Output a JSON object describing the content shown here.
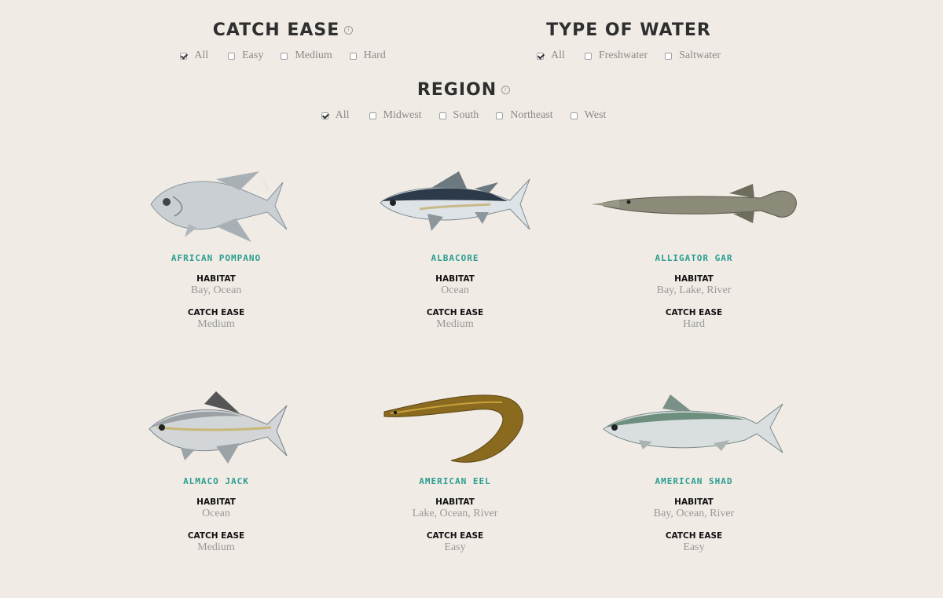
{
  "filters": {
    "catch_ease": {
      "title": "CATCH EASE",
      "info_icon": "info-icon",
      "options": [
        {
          "label": "All",
          "checked": true
        },
        {
          "label": "Easy",
          "checked": false
        },
        {
          "label": "Medium",
          "checked": false
        },
        {
          "label": "Hard",
          "checked": false
        }
      ]
    },
    "water": {
      "title": "TYPE OF WATER",
      "options": [
        {
          "label": "All",
          "checked": true
        },
        {
          "label": "Freshwater",
          "checked": false
        },
        {
          "label": "Saltwater",
          "checked": false
        }
      ]
    },
    "region": {
      "title": "REGION",
      "info_icon": "info-icon",
      "options": [
        {
          "label": "All",
          "checked": true
        },
        {
          "label": "Midwest",
          "checked": false
        },
        {
          "label": "South",
          "checked": false
        },
        {
          "label": "Northeast",
          "checked": false
        },
        {
          "label": "West",
          "checked": false
        }
      ]
    }
  },
  "labels": {
    "habitat": "HABITAT",
    "catch_ease": "CATCH EASE"
  },
  "fish": [
    {
      "name": "AFRICAN POMPANO",
      "habitat": "Bay, Ocean",
      "ease": "Medium"
    },
    {
      "name": "ALBACORE",
      "habitat": "Ocean",
      "ease": "Medium"
    },
    {
      "name": "ALLIGATOR GAR",
      "habitat": "Bay, Lake, River",
      "ease": "Hard"
    },
    {
      "name": "ALMACO JACK",
      "habitat": "Ocean",
      "ease": "Medium"
    },
    {
      "name": "AMERICAN EEL",
      "habitat": "Lake, Ocean, River",
      "ease": "Easy"
    },
    {
      "name": "AMERICAN SHAD",
      "habitat": "Bay, Ocean, River",
      "ease": "Easy"
    }
  ]
}
